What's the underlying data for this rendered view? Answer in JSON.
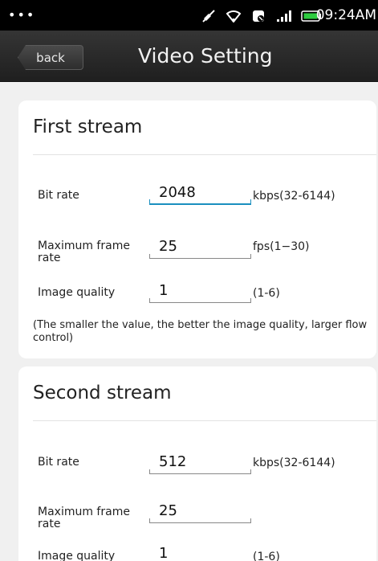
{
  "status_bar": {
    "dots": "•••",
    "time": "09:24AM",
    "icons": [
      "mute-icon",
      "wifi-icon",
      "data-icon",
      "signal-icon",
      "battery-icon"
    ]
  },
  "header": {
    "back_label": "back",
    "title": "Video Setting"
  },
  "first_stream": {
    "title": "First stream",
    "fields": [
      {
        "label": "Bit rate",
        "value": "2048",
        "unit": "kbps(32-6144)"
      },
      {
        "label": "Maximum frame rate",
        "value": "25",
        "unit": "fps(1−30)"
      },
      {
        "label": "Image quality",
        "value": "1",
        "unit": "(1-6)"
      }
    ],
    "note": "(The smaller the value, the better the image quality, larger flow control)"
  },
  "second_stream": {
    "title": "Second stream",
    "fields": [
      {
        "label": "Bit rate",
        "value": "512",
        "unit": "kbps(32-6144)"
      },
      {
        "label": "Maximum frame rate",
        "value": "25",
        "unit": ""
      },
      {
        "label": "Image quality",
        "value": "1",
        "unit": "(1-6)"
      }
    ]
  },
  "colors": {
    "focus_accent": "#1a8fbf",
    "header_bg": "#2a2a2a",
    "page_bg": "#f0f0f0"
  }
}
